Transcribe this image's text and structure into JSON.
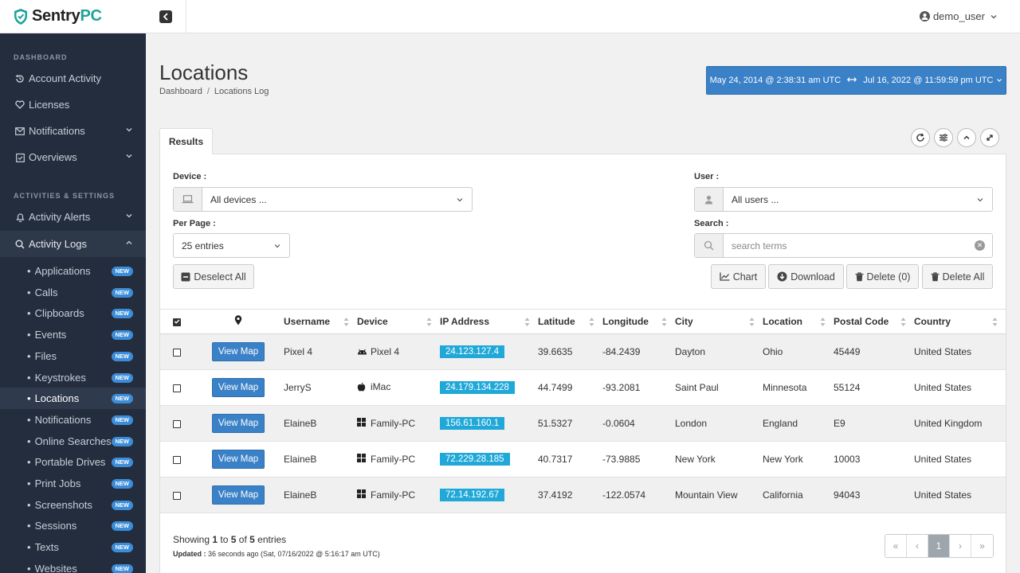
{
  "brand": {
    "name_a": "Sentry",
    "name_b": "PC"
  },
  "sidebar": {
    "section_dashboard": "DASHBOARD",
    "section_activities": "ACTIVITIES & SETTINGS",
    "items": [
      {
        "label": "Account Activity"
      },
      {
        "label": "Licenses"
      },
      {
        "label": "Notifications"
      },
      {
        "label": "Overviews"
      },
      {
        "label": "Activity Alerts"
      },
      {
        "label": "Activity Logs"
      }
    ],
    "sub_items": [
      {
        "label": "Applications",
        "badge": "NEW"
      },
      {
        "label": "Calls",
        "badge": "NEW"
      },
      {
        "label": "Clipboards",
        "badge": "NEW"
      },
      {
        "label": "Events",
        "badge": "NEW"
      },
      {
        "label": "Files",
        "badge": "NEW"
      },
      {
        "label": "Keystrokes",
        "badge": "NEW"
      },
      {
        "label": "Locations",
        "badge": "NEW"
      },
      {
        "label": "Notifications",
        "badge": "NEW"
      },
      {
        "label": "Online Searches",
        "badge": "NEW"
      },
      {
        "label": "Portable Drives",
        "badge": "NEW"
      },
      {
        "label": "Print Jobs",
        "badge": "NEW"
      },
      {
        "label": "Screenshots",
        "badge": "NEW"
      },
      {
        "label": "Sessions",
        "badge": "NEW"
      },
      {
        "label": "Texts",
        "badge": "NEW"
      },
      {
        "label": "Websites",
        "badge": "NEW"
      }
    ],
    "active_sub": "Locations"
  },
  "topbar": {
    "username": "demo_user"
  },
  "header": {
    "title": "Locations",
    "breadcrumb": [
      "Dashboard",
      "Locations Log"
    ],
    "date_from": "May 24, 2014 @ 2:38:31 am UTC",
    "date_to": "Jul 16, 2022 @ 11:59:59 pm UTC"
  },
  "panel": {
    "tab": "Results",
    "device_label": "Device :",
    "device_value": "All devices ...",
    "user_label": "User :",
    "user_value": "All users ...",
    "perpage_label": "Per Page :",
    "perpage_value": "25 entries",
    "search_label": "Search :",
    "search_placeholder": "search terms",
    "search_value": "",
    "buttons": {
      "deselect": "Deselect All",
      "chart": "Chart",
      "download": "Download",
      "delete": "Delete (0)",
      "delete_all": "Delete All"
    }
  },
  "table": {
    "columns": [
      "Username",
      "Device",
      "IP Address",
      "Latitude",
      "Longitude",
      "City",
      "Location",
      "Postal Code",
      "Country"
    ],
    "view_map_label": "View Map",
    "rows": [
      {
        "username": "Pixel 4",
        "device": "Pixel 4",
        "device_icon": "android-icon",
        "ip": "24.123.127.4",
        "lat": "39.6635",
        "lon": "-84.2439",
        "city": "Dayton",
        "location": "Ohio",
        "postal": "45449",
        "country": "United States"
      },
      {
        "username": "JerryS",
        "device": "iMac",
        "device_icon": "apple-icon",
        "ip": "24.179.134.228",
        "lat": "44.7499",
        "lon": "-93.2081",
        "city": "Saint Paul",
        "location": "Minnesota",
        "postal": "55124",
        "country": "United States"
      },
      {
        "username": "ElaineB",
        "device": "Family-PC",
        "device_icon": "windows-icon",
        "ip": "156.61.160.1",
        "lat": "51.5327",
        "lon": "-0.0604",
        "city": "London",
        "location": "England",
        "postal": "E9",
        "country": "United Kingdom"
      },
      {
        "username": "ElaineB",
        "device": "Family-PC",
        "device_icon": "windows-icon",
        "ip": "72.229.28.185",
        "lat": "40.7317",
        "lon": "-73.9885",
        "city": "New York",
        "location": "New York",
        "postal": "10003",
        "country": "United States"
      },
      {
        "username": "ElaineB",
        "device": "Family-PC",
        "device_icon": "windows-icon",
        "ip": "72.14.192.67",
        "lat": "37.4192",
        "lon": "-122.0574",
        "city": "Mountain View",
        "location": "California",
        "postal": "94043",
        "country": "United States"
      }
    ]
  },
  "footer": {
    "showing_prefix": "Showing ",
    "showing_from": "1",
    "showing_to_word": " to ",
    "showing_to": "5",
    "showing_of_word": " of ",
    "showing_total": "5",
    "showing_suffix": " entries",
    "updated_label": "Updated :",
    "updated_text": " 36 seconds ago (Sat, 07/16/2022 @ 5:16:17 am UTC)",
    "page": "1",
    "pager_first": "«",
    "pager_prev": "‹",
    "pager_next": "›",
    "pager_last": "»"
  },
  "colors": {
    "sidebar_bg": "#232d3d",
    "primary": "#3a81c7",
    "ip_badge": "#20a8d8",
    "brand_teal": "#1fa39a"
  }
}
